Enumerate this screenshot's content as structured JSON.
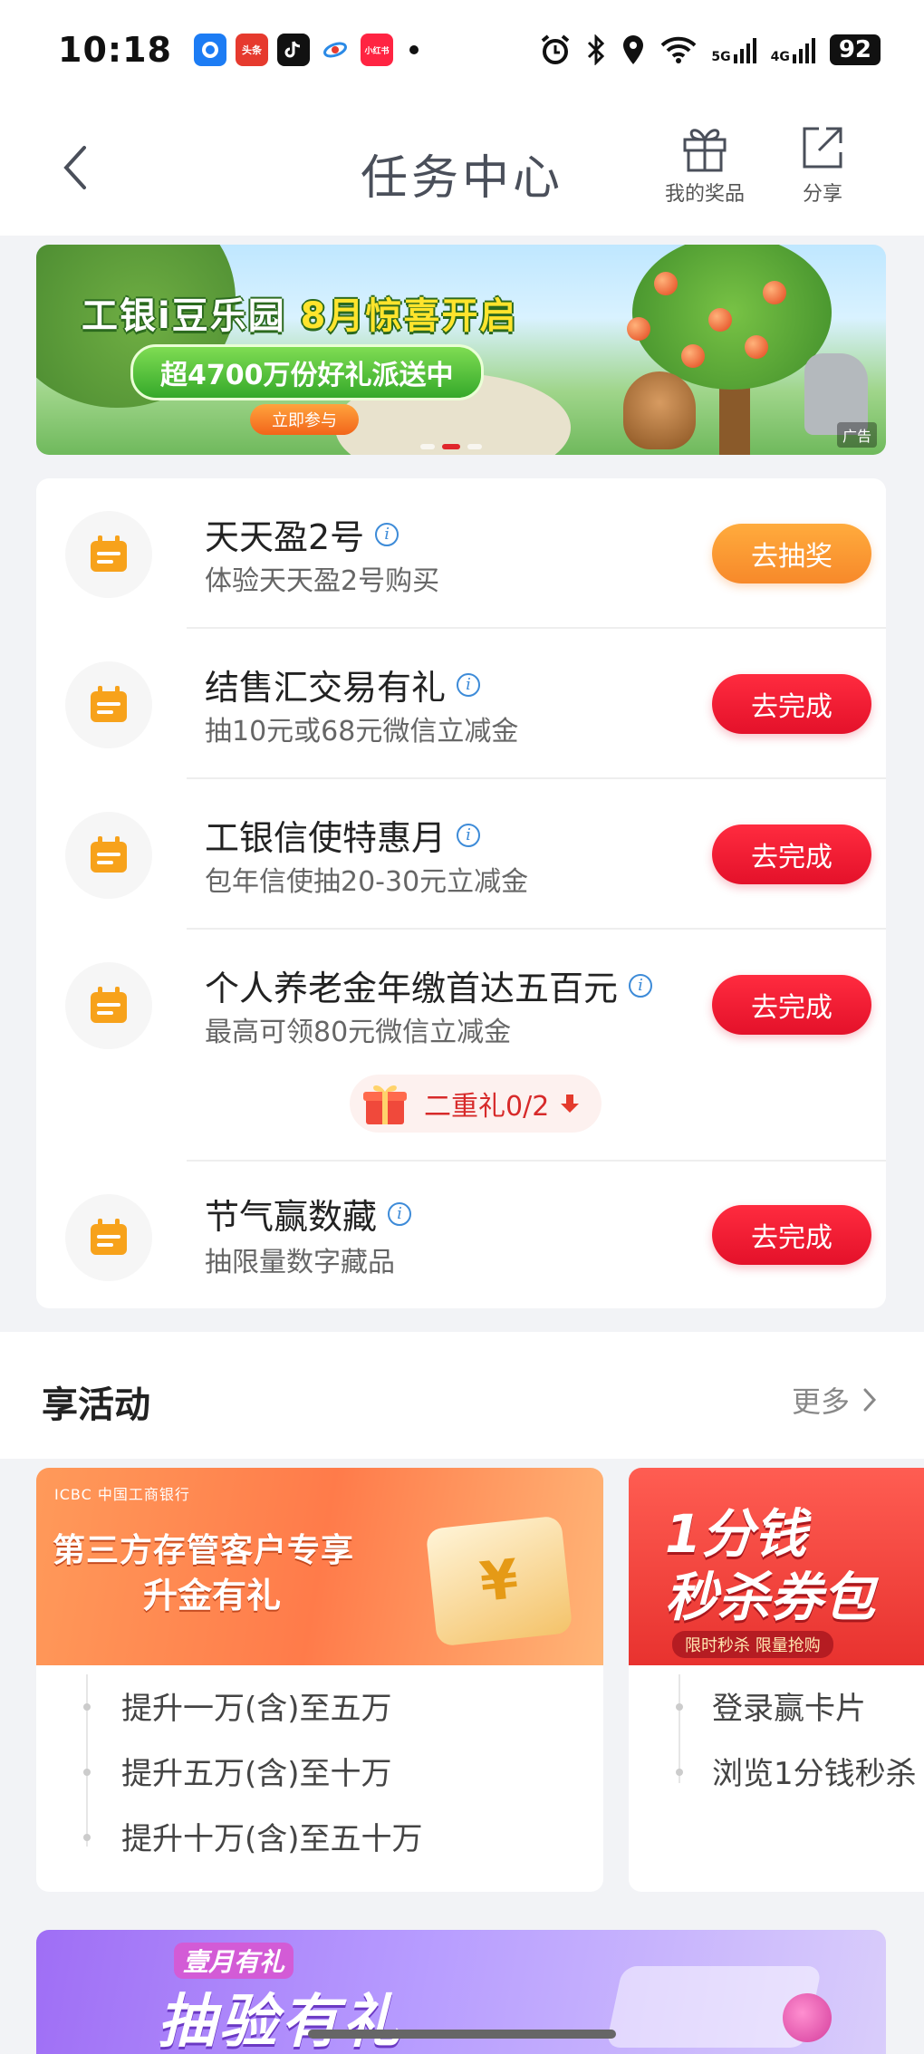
{
  "status_bar": {
    "time": "10:18",
    "apps": [
      {
        "name": "app-icon-1",
        "label": "",
        "color": "#1c7cf4"
      },
      {
        "name": "toutiao-icon",
        "label": "头条",
        "color": "#e63a2e"
      },
      {
        "name": "tiktok-icon",
        "label": "",
        "color": "#111111"
      },
      {
        "name": "telecom-icon",
        "label": "",
        "color": "#2b8ae6"
      },
      {
        "name": "xiaohongshu-icon",
        "label": "小红书",
        "color": "#ff2442"
      }
    ],
    "network_5g": "5G",
    "network_4g": "4G",
    "battery": "92"
  },
  "header": {
    "title": "任务中心",
    "prizes_label": "我的奖品",
    "share_label": "分享"
  },
  "banner": {
    "title_part1": "工银i豆乐园",
    "title_part2": "8月惊喜开启",
    "subtitle": "超4700万份好礼派送中",
    "cta": "立即参与",
    "ad_label": "广告"
  },
  "tasks": [
    {
      "title": "天天盈2号",
      "desc": "体验天天盈2号购买",
      "button": "去抽奖",
      "style": "orange"
    },
    {
      "title": "结售汇交易有礼",
      "desc": "抽10元或68元微信立减金",
      "button": "去完成",
      "style": "red"
    },
    {
      "title": "工银信使特惠月",
      "desc": "包年信使抽20-30元立减金",
      "button": "去完成",
      "style": "red"
    },
    {
      "title": "个人养老金年缴首达五百元",
      "desc": "最高可领80元微信立减金",
      "button": "去完成",
      "style": "red",
      "gift": "二重礼0/2"
    },
    {
      "title": "节气赢数藏",
      "desc": "抽限量数字藏品",
      "button": "去完成",
      "style": "red"
    }
  ],
  "activities": {
    "title": "享活动",
    "more": "更多",
    "cards": [
      {
        "logo": "ICBC 中国工商银行",
        "headline1": "第三方存管客户专享",
        "headline2": "升金有礼",
        "items": [
          "提升一万(含)至五万",
          "提升五万(含)至十万",
          "提升十万(含)至五十万"
        ]
      },
      {
        "headline1": "1分钱",
        "headline2": "秒杀券包",
        "tag": "限时秒杀 限量抢购",
        "items": [
          "登录赢卡片",
          "浏览1分钱秒杀"
        ]
      }
    ]
  },
  "promo": {
    "small": "壹月有礼",
    "big": "抽验有礼"
  },
  "colors": {
    "accent_red": "#e4112a",
    "accent_orange": "#f7892a",
    "task_icon": "#f7a21b"
  }
}
